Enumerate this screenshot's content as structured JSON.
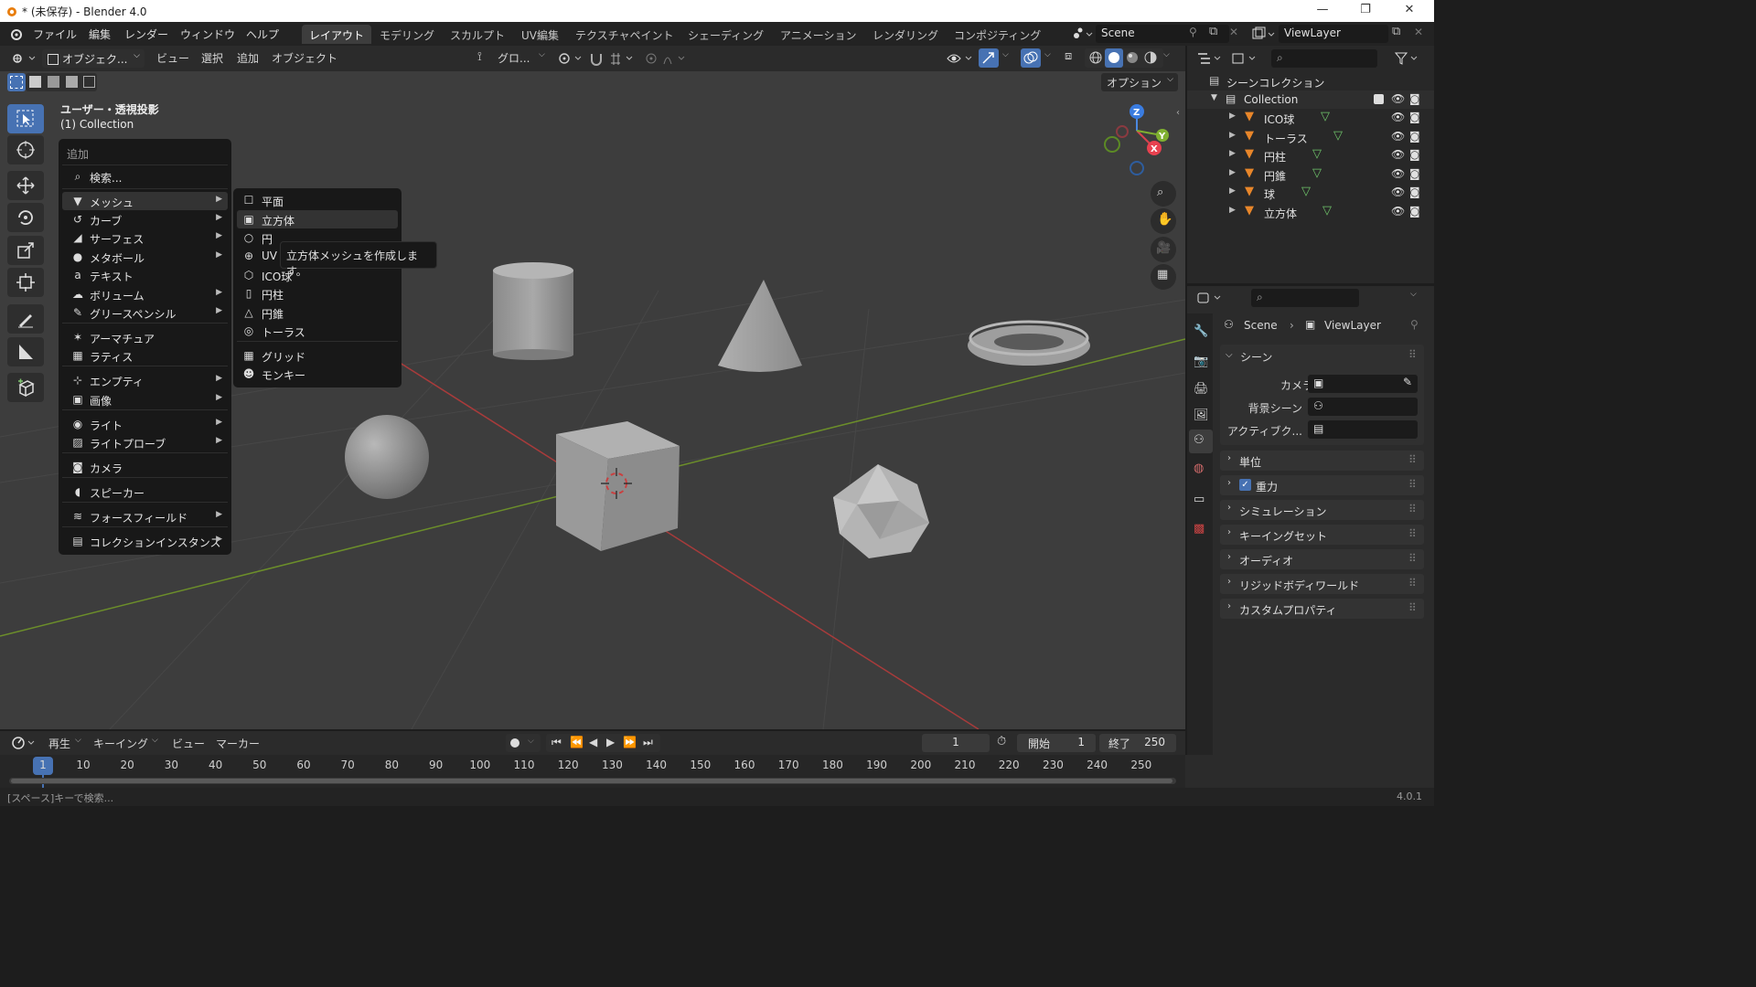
{
  "window": {
    "title": "* (未保存) - Blender 4.0",
    "minimize": "—",
    "maximize": "❐",
    "close": "✕"
  },
  "menubar": {
    "items": [
      "ファイル",
      "編集",
      "レンダー",
      "ウィンドウ",
      "ヘルプ"
    ]
  },
  "workspaces": {
    "tabs": [
      "レイアウト",
      "モデリング",
      "スカルプト",
      "UV編集",
      "テクスチャペイント",
      "シェーディング",
      "アニメーション",
      "レンダリング",
      "コンポジティング"
    ],
    "active": "レイアウト"
  },
  "scene_field": "Scene",
  "viewlayer_field": "ViewLayer",
  "viewport_header": {
    "mode": "オブジェク...",
    "menus": [
      "ビュー",
      "選択",
      "追加",
      "オブジェクト"
    ],
    "transform": "グロ...",
    "options": "オプション"
  },
  "viewport": {
    "view_name": "ユーザー・透視投影",
    "collection_label": "(1) Collection",
    "axes": {
      "x": "X",
      "y": "Y",
      "z": "Z"
    }
  },
  "add_menu": {
    "title": "追加",
    "search": "検索...",
    "items": [
      {
        "label": "メッシュ",
        "icon": "mesh-icon",
        "submenu": true
      },
      {
        "label": "カーブ",
        "icon": "curve-icon",
        "submenu": true
      },
      {
        "label": "サーフェス",
        "icon": "surface-icon",
        "submenu": true
      },
      {
        "label": "メタボール",
        "icon": "metaball-icon",
        "submenu": true
      },
      {
        "label": "テキスト",
        "icon": "text-icon",
        "submenu": false
      },
      {
        "label": "ボリューム",
        "icon": "volume-icon",
        "submenu": true
      },
      {
        "label": "グリースペンシル",
        "icon": "grease-pencil-icon",
        "submenu": true
      },
      {
        "label": "アーマチュア",
        "icon": "armature-icon",
        "submenu": false
      },
      {
        "label": "ラティス",
        "icon": "lattice-icon",
        "submenu": false
      },
      {
        "label": "エンプティ",
        "icon": "empty-icon",
        "submenu": true
      },
      {
        "label": "画像",
        "icon": "image-icon",
        "submenu": true
      },
      {
        "label": "ライト",
        "icon": "light-icon",
        "submenu": true
      },
      {
        "label": "ライトプローブ",
        "icon": "light-probe-icon",
        "submenu": true
      },
      {
        "label": "カメラ",
        "icon": "camera-icon",
        "submenu": false
      },
      {
        "label": "スピーカー",
        "icon": "speaker-icon",
        "submenu": false
      },
      {
        "label": "フォースフィールド",
        "icon": "force-field-icon",
        "submenu": true
      },
      {
        "label": "コレクションインスタンス",
        "icon": "collection-instance-icon",
        "submenu": true
      }
    ]
  },
  "mesh_menu": {
    "items": [
      "平面",
      "立方体",
      "円",
      "UV球",
      "ICO球",
      "円柱",
      "円錐",
      "トーラス",
      "グリッド",
      "モンキー"
    ],
    "uv_visible": "UV",
    "highlighted": "立方体"
  },
  "tooltip": "立方体メッシュを作成します。",
  "outliner": {
    "root": "シーンコレクション",
    "collection": "Collection",
    "objects": [
      "ICO球",
      "トーラス",
      "円柱",
      "円錐",
      "球",
      "立方体"
    ]
  },
  "properties": {
    "breadcrumb_scene": "Scene",
    "breadcrumb_viewlayer": "ViewLayer",
    "section": "シーン",
    "fields": {
      "camera": "カメラ",
      "background_scene": "背景シーン",
      "active_clip": "アクティブク..."
    },
    "panels": [
      "単位",
      "重力",
      "シミュレーション",
      "キーイングセット",
      "オーディオ",
      "リジッドボディワールド",
      "カスタムプロパティ"
    ]
  },
  "timeline": {
    "menus": [
      "再生",
      "キーイング",
      "ビュー",
      "マーカー"
    ],
    "current_frame": "1",
    "start_label": "開始",
    "start": "1",
    "end_label": "終了",
    "end": "250",
    "ruler": [
      "10",
      "20",
      "30",
      "40",
      "50",
      "60",
      "70",
      "80",
      "90",
      "100",
      "110",
      "120",
      "130",
      "140",
      "150",
      "160",
      "170",
      "180",
      "190",
      "200",
      "210",
      "220",
      "230",
      "240",
      "250"
    ]
  },
  "statusbar": {
    "hint": "[スペース]キーで検索...",
    "version": "4.0.1"
  }
}
